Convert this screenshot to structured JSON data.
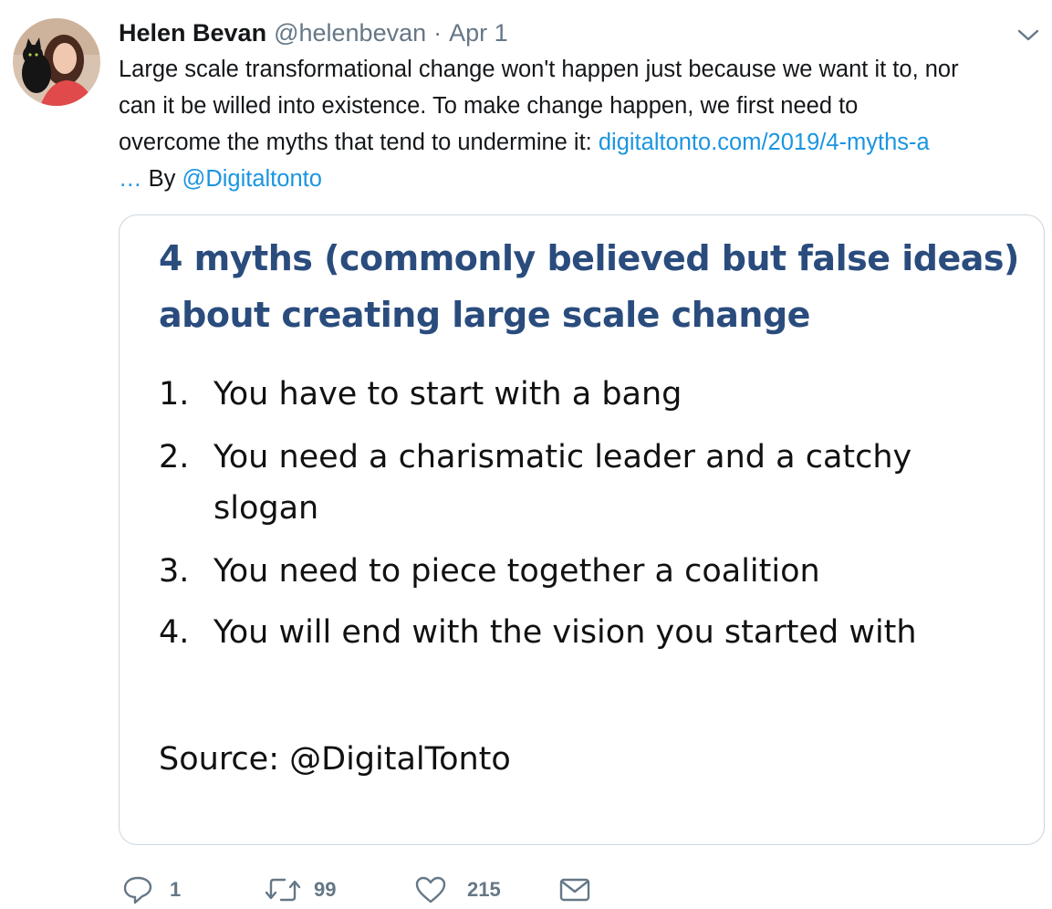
{
  "tweet": {
    "author_name": "Helen Bevan",
    "author_handle": "@helenbevan",
    "separator": "·",
    "date": "Apr 1",
    "text_part1": "Large scale transformational change won't happen just because we want it to, nor\ncan it be willed into existence. To make change happen, we first need to\novercome the myths that tend to undermine it: ",
    "link_text": "digitaltonto.com/2019/4-myths-a",
    "link_ellipsis": "…",
    "text_part2": " By ",
    "mention": "@Digitaltonto"
  },
  "media": {
    "title": "4 myths (commonly believed but false ideas) about creating large scale change",
    "items": [
      {
        "num": "1.",
        "text": "You have to start with a bang"
      },
      {
        "num": "2.",
        "text": "You need a charismatic leader and a catchy\nslogan"
      },
      {
        "num": "3.",
        "text": "You need to piece together a coalition"
      },
      {
        "num": "4.",
        "text": "You will end with the vision you started with"
      }
    ],
    "source": "Source:  @DigitalTonto",
    "title_color": "#2a4c7d"
  },
  "actions": {
    "reply_count": "1",
    "retweet_count": "99",
    "like_count": "215",
    "reply_icon": "reply-icon",
    "retweet_icon": "retweet-icon",
    "like_icon": "heart-icon",
    "message_icon": "envelope-icon"
  },
  "colors": {
    "link": "#1b95e0",
    "secondary_text": "#657786",
    "border": "#ccd6dd"
  }
}
